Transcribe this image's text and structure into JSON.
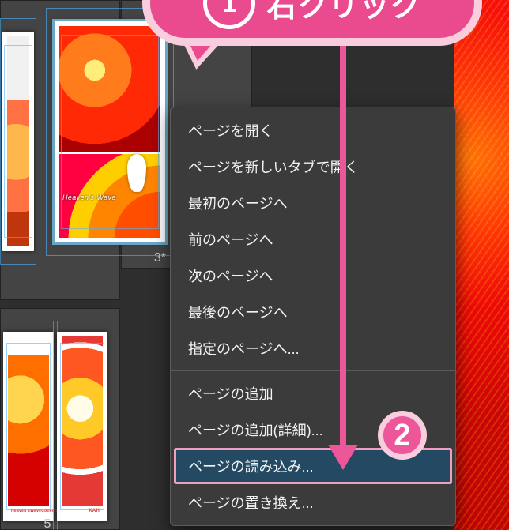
{
  "pages": {
    "p3_label": "3*",
    "p5_label": "5",
    "p3_caption": "Heaven's Wave",
    "p4_caption": "Heaven'sWaveCollections",
    "p5_caption": "KAH"
  },
  "context_menu": {
    "items": [
      {
        "label": "ページを開く"
      },
      {
        "label": "ページを新しいタブで開く"
      },
      {
        "label": "最初のページへ"
      },
      {
        "label": "前のページへ"
      },
      {
        "label": "次のページへ"
      },
      {
        "label": "最後のページへ"
      },
      {
        "label": "指定のページへ..."
      }
    ],
    "items2": [
      {
        "label": "ページの追加"
      },
      {
        "label": "ページの追加(詳細)..."
      },
      {
        "label": "ページの読み込み...",
        "highlight": true
      },
      {
        "label": "ページの置き換え..."
      }
    ]
  },
  "annotations": {
    "step1_label": "右クリック",
    "step1_num": "1",
    "step2_num": "2"
  },
  "colors": {
    "accent_pink": "#ea4a8e",
    "accent_pink_light": "#f8cddd",
    "menu_highlight": "#244a63"
  }
}
